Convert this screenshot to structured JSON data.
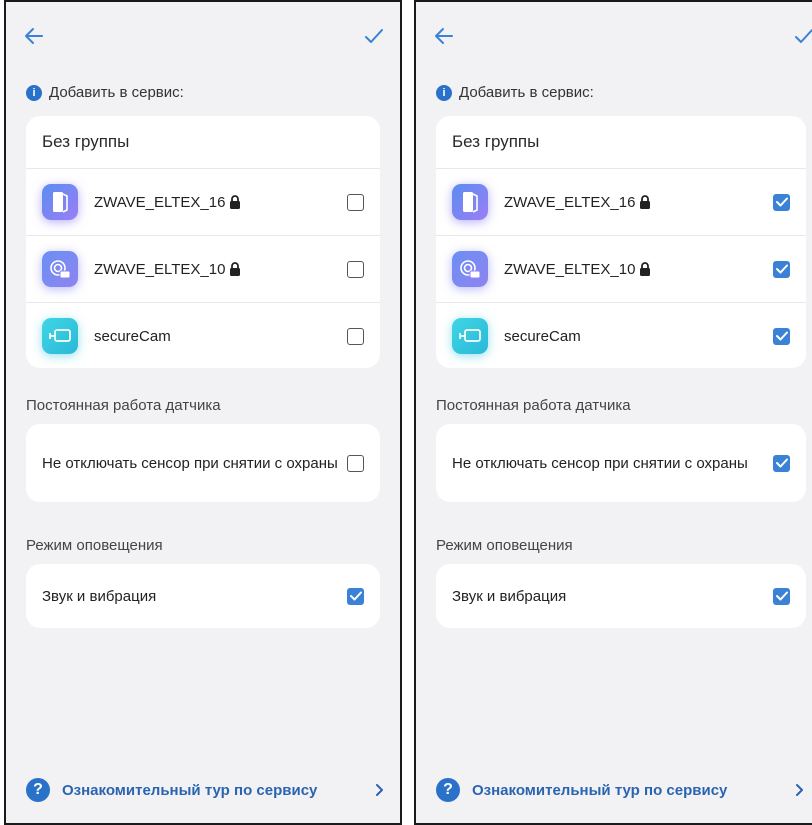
{
  "colors": {
    "accent": "#3b82d6",
    "link": "#2a64b0",
    "background": "#f2f2f4"
  },
  "panels": [
    {
      "id": "left",
      "add_to_service_label": "Добавить в сервис:",
      "group_title": "Без группы",
      "devices": [
        {
          "name": "ZWAVE_ELTEX_16",
          "icon": "door-sensor-icon",
          "locked": true,
          "checked": false
        },
        {
          "name": "ZWAVE_ELTEX_10",
          "icon": "motion-sensor-icon",
          "locked": true,
          "checked": false
        },
        {
          "name": "secureCam",
          "icon": "camera-icon",
          "locked": false,
          "checked": false
        }
      ],
      "sensor_section_title": "Постоянная работа датчика",
      "sensor_option_label": "Не отключать сенсор при снятии с охраны",
      "sensor_option_checked": false,
      "notify_section_title": "Режим оповещения",
      "notify_option_label": "Звук и вибрация",
      "notify_option_checked": true,
      "tour_label": "Ознакомительный тур по сервису"
    },
    {
      "id": "right",
      "add_to_service_label": "Добавить в сервис:",
      "group_title": "Без группы",
      "devices": [
        {
          "name": "ZWAVE_ELTEX_16",
          "icon": "door-sensor-icon",
          "locked": true,
          "checked": true
        },
        {
          "name": "ZWAVE_ELTEX_10",
          "icon": "motion-sensor-icon",
          "locked": true,
          "checked": true
        },
        {
          "name": "secureCam",
          "icon": "camera-icon",
          "locked": false,
          "checked": true
        }
      ],
      "sensor_section_title": "Постоянная работа датчика",
      "sensor_option_label": "Не отключать сенсор при снятии с охраны",
      "sensor_option_checked": true,
      "notify_section_title": "Режим оповещения",
      "notify_option_label": "Звук и вибрация",
      "notify_option_checked": true,
      "tour_label": "Ознакомительный тур по сервису"
    }
  ]
}
